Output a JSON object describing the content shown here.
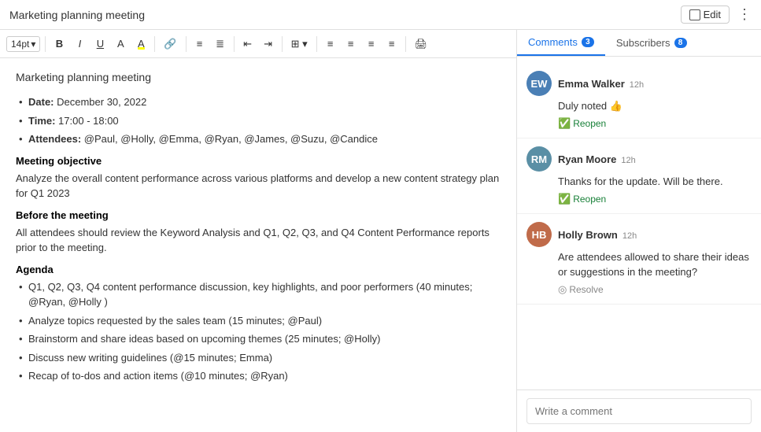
{
  "header": {
    "title": "Marketing planning meeting",
    "edit_label": "Edit"
  },
  "toolbar": {
    "font_size": "14pt",
    "chevron": "▾"
  },
  "document": {
    "title": "Marketing planning meeting",
    "bullets_info": [
      {
        "label": "Date:",
        "value": "December 30, 2022"
      },
      {
        "label": "Time:",
        "value": "17:00 - 18:00"
      },
      {
        "label": "Attendees:",
        "value": "@Paul, @Holly, @Emma, @Ryan, @James, @Suzu, @Candice"
      }
    ],
    "section1_heading": "Meeting objective",
    "section1_body": "Analyze the overall content performance across various platforms and develop a new content strategy plan for Q1 2023",
    "section2_heading": "Before the meeting",
    "section2_body": "All attendees should review the Keyword Analysis and Q1, Q2, Q3, and Q4 Content Performance reports prior to the meeting.",
    "section3_heading": "Agenda",
    "agenda_items": [
      "Q1, Q2, Q3, Q4 content performance discussion, key highlights, and poor performers (40 minutes; @Ryan, @Holly )",
      "Analyze topics requested by the sales team (15 minutes; @Paul)",
      "Brainstorm and share ideas based on upcoming themes (25 minutes; @Holly)",
      "Discuss new writing guidelines (@15 minutes; Emma)",
      "Recap of to-dos and action items (@10 minutes; @Ryan)"
    ]
  },
  "tabs": {
    "comments_label": "Comments",
    "comments_count": "3",
    "subscribers_label": "Subscribers",
    "subscribers_count": "8"
  },
  "comments": [
    {
      "author": "Emma Walker",
      "time": "12h",
      "text": "Duly noted 👍",
      "action": "Reopen",
      "action_type": "reopen",
      "avatar_initials": "EW"
    },
    {
      "author": "Ryan Moore",
      "time": "12h",
      "text": "Thanks for the update. Will be there.",
      "action": "Reopen",
      "action_type": "reopen",
      "avatar_initials": "RM"
    },
    {
      "author": "Holly Brown",
      "time": "12h",
      "text": "Are attendees allowed to share their ideas or suggestions in the meeting?",
      "action": "Resolve",
      "action_type": "resolve",
      "avatar_initials": "HB"
    }
  ],
  "comment_input_placeholder": "Write a comment"
}
